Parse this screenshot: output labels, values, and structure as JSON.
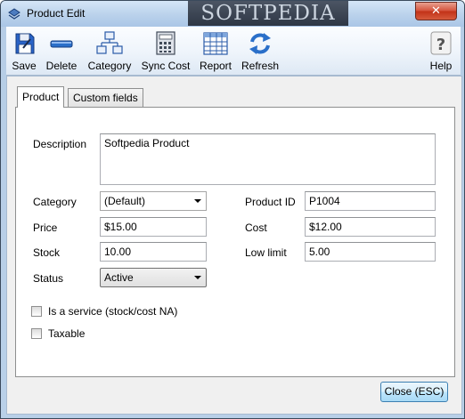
{
  "window": {
    "title": "Product Edit",
    "close_glyph": "✕",
    "watermark": "SOFTPEDIA"
  },
  "toolbar": {
    "items": [
      {
        "label": "Save",
        "icon": "floppy-disk-icon"
      },
      {
        "label": "Delete",
        "icon": "blue-bar-icon"
      },
      {
        "label": "Category",
        "icon": "hierarchy-icon"
      },
      {
        "label": "Sync Cost",
        "icon": "calculator-icon"
      },
      {
        "label": "Report",
        "icon": "table-grid-icon"
      },
      {
        "label": "Refresh",
        "icon": "refresh-arrows-icon"
      },
      {
        "label": "Help",
        "icon": "question-mark-icon"
      }
    ]
  },
  "tabs": [
    {
      "label": "Product",
      "active": true
    },
    {
      "label": "Custom fields",
      "active": false
    }
  ],
  "form": {
    "description_label": "Description",
    "description_value": "Softpedia Product",
    "category_label": "Category",
    "category_value": "(Default)",
    "product_id_label": "Product ID",
    "product_id_value": "P1004",
    "price_label": "Price",
    "price_value": "$15.00",
    "cost_label": "Cost",
    "cost_value": "$12.00",
    "stock_label": "Stock",
    "stock_value": "10.00",
    "low_limit_label": "Low limit",
    "low_limit_value": "5.00",
    "status_label": "Status",
    "status_value": "Active",
    "service_label": "Is a service (stock/cost NA)",
    "service_checked": false,
    "taxable_label": "Taxable",
    "taxable_checked": false
  },
  "footer": {
    "close_button": "Close (ESC)"
  },
  "colors": {
    "title_bar": "#bcd3ec",
    "close_red": "#c23218",
    "toolbar_blue": "#2a6fc9"
  }
}
